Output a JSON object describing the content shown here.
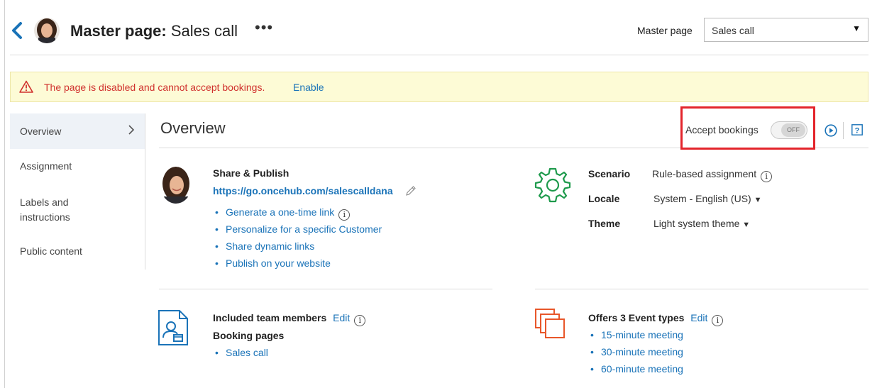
{
  "header": {
    "title_bold": "Master page:",
    "title_rest": "Sales call",
    "more": "•••",
    "master_page_label": "Master page",
    "master_page_value": "Sales call"
  },
  "banner": {
    "message": "The page is disabled and cannot accept bookings.",
    "enable": "Enable"
  },
  "sidebar": {
    "items": [
      {
        "label": "Overview"
      },
      {
        "label": "Assignment"
      },
      {
        "label": "Labels and instructions"
      },
      {
        "label": "Public content"
      }
    ]
  },
  "overview": {
    "title": "Overview",
    "accept_bookings_label": "Accept bookings",
    "toggle_text": "OFF"
  },
  "share": {
    "title": "Share & Publish",
    "url": "https://go.oncehub.com/salescalldana",
    "links": [
      "Generate a one-time link",
      "Personalize for a specific Customer",
      "Share dynamic links",
      "Publish on your website"
    ]
  },
  "settings": {
    "scenario_label": "Scenario",
    "scenario_value": "Rule-based assignment",
    "locale_label": "Locale",
    "locale_value": "System - English (US)",
    "theme_label": "Theme",
    "theme_value": "Light system theme"
  },
  "team": {
    "title": "Included team members",
    "edit": "Edit",
    "booking_pages_title": "Booking pages",
    "booking_pages": [
      "Sales call"
    ]
  },
  "events": {
    "title": "Offers 3 Event types",
    "edit": "Edit",
    "items": [
      "15-minute meeting",
      "30-minute meeting",
      "60-minute meeting"
    ]
  },
  "icons": {
    "info_glyph": "i",
    "dropdown_glyph": "▼"
  },
  "colors": {
    "link": "#1a73b8",
    "warning": "#d0312d",
    "banner_bg": "#fdfbd6",
    "highlight": "#e3242b",
    "gear": "#1e9a4c",
    "events_icon": "#e8572a"
  }
}
